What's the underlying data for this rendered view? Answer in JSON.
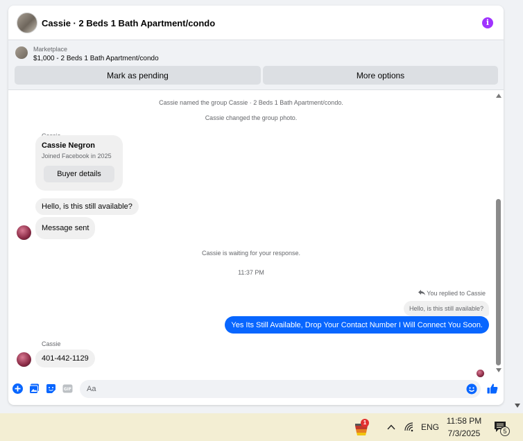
{
  "header": {
    "title": "Cassie · 2 Beds 1 Bath Apartment/condo",
    "info_icon": "i"
  },
  "marketplace": {
    "label": "Marketplace",
    "listing": "$1,000 - 2 Beds 1 Bath Apartment/condo",
    "mark_pending": "Mark as pending",
    "more_options": "More options"
  },
  "thread": {
    "sys1": "Cassie named the group Cassie · 2 Beds 1 Bath Apartment/condo.",
    "sys2": "Cassie changed the group photo.",
    "sender1": "Cassie",
    "card": {
      "name": "Cassie Negron",
      "joined": "Joined Facebook in 2025",
      "button": "Buyer details"
    },
    "msg1": "Hello, is this still available?",
    "msg2": "Message sent",
    "waiting": "Cassie is waiting for your response.",
    "time": "11:37 PM",
    "replied": "You replied to Cassie",
    "quoted": "Hello, is this still available?",
    "outgoing": "Yes Its Still Available, Drop Your Contact Number I Will Connect You Soon.",
    "sender2": "Cassie",
    "msg3": "401-442-1129"
  },
  "composer": {
    "placeholder": "Aa"
  },
  "taskbar": {
    "app_badge": "1",
    "language": "ENG",
    "time": "11:58 PM",
    "date": "7/3/2025",
    "notification_count": "5"
  },
  "colors": {
    "accent": "#0866ff",
    "info": "#a033ff"
  }
}
